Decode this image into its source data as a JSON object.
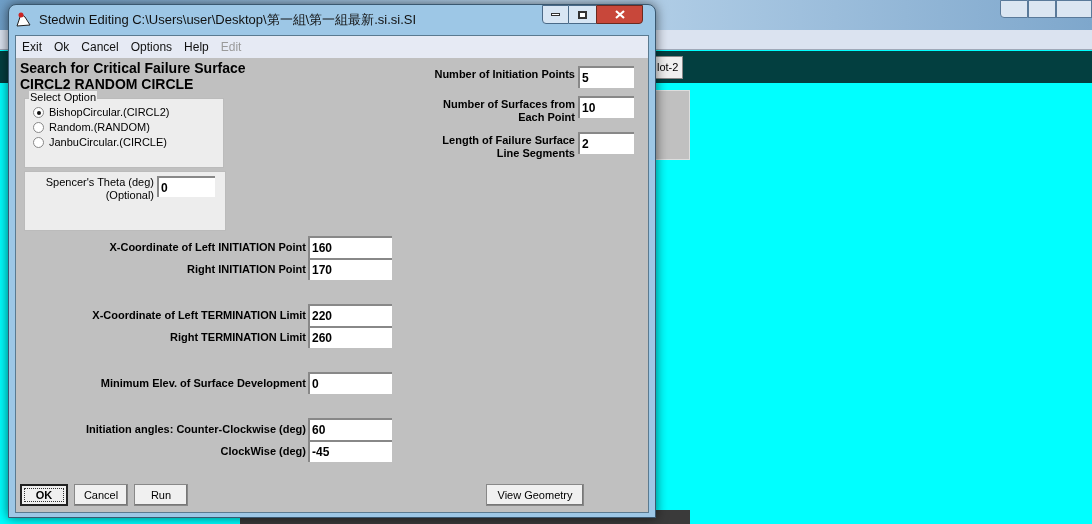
{
  "window": {
    "title": "Stedwin Editing C:\\Users\\user\\Desktop\\第一組\\第一組最新.si.si.SI"
  },
  "menu": [
    {
      "label": "Exit",
      "disabled": false
    },
    {
      "label": "Ok",
      "disabled": false
    },
    {
      "label": "Cancel",
      "disabled": false
    },
    {
      "label": "Options",
      "disabled": false
    },
    {
      "label": "Help",
      "disabled": false
    },
    {
      "label": "Edit",
      "disabled": true
    }
  ],
  "heading": {
    "title": "Search for Critical Failure Surface",
    "subtitle": "CIRCL2 RANDOM CIRCLE"
  },
  "select_option": {
    "label": "Select Option",
    "options": [
      {
        "label": "BishopCircular.(CIRCL2)",
        "selected": true
      },
      {
        "label": "Random.(RANDOM)",
        "selected": false
      },
      {
        "label": "JanbuCircular.(CIRCLE)",
        "selected": false
      }
    ]
  },
  "spencer": {
    "label": "Spencer's Theta (deg)",
    "note": "(Optional)",
    "value": "0"
  },
  "right_fields": [
    {
      "lines": [
        "Number of Initiation Points"
      ],
      "value": "5"
    },
    {
      "lines": [
        "Number of Surfaces from",
        "Each Point"
      ],
      "value": "10"
    },
    {
      "lines": [
        "Length of Failure Surface",
        "Line Segments"
      ],
      "value": "2"
    }
  ],
  "left_field_groups": [
    [
      {
        "label": "X-Coordinate of Left INITIATION Point",
        "value": "160"
      },
      {
        "label": "Right INITIATION Point",
        "value": "170"
      }
    ],
    [
      {
        "label": "X-Coordinate of Left TERMINATION Limit",
        "value": "220"
      },
      {
        "label": "Right TERMINATION Limit",
        "value": "260"
      }
    ],
    [
      {
        "label": "Minimum Elev. of Surface Development",
        "value": "0"
      }
    ],
    [
      {
        "label": "Initiation angles: Counter-Clockwise (deg)",
        "value": "60"
      },
      {
        "label": "ClockWise (deg)",
        "value": "-45"
      }
    ]
  ],
  "buttons": [
    {
      "label": "OK",
      "default": true
    },
    {
      "label": "Cancel",
      "default": false
    },
    {
      "label": "Run",
      "default": false
    }
  ],
  "view_geometry_button": "View Geometry",
  "background_window": {
    "tab_button": "lot-2"
  }
}
